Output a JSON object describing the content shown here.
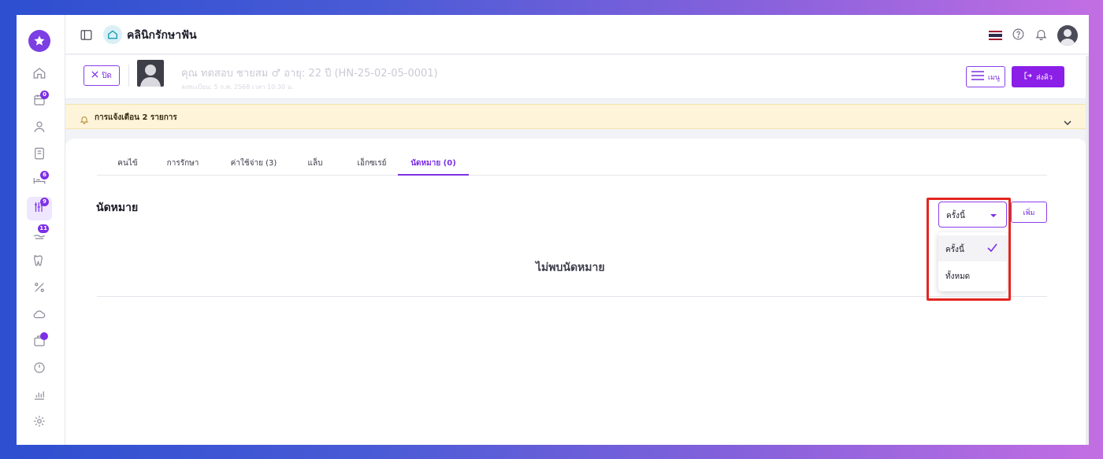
{
  "app": {
    "title": "คลินิกรักษาฟัน",
    "accent_color": "#7c2fe5",
    "flag": "thai-flag"
  },
  "sidebar": {
    "items": [
      {
        "icon": "home-icon",
        "badge": ""
      },
      {
        "icon": "calendar-icon",
        "badge": "0"
      },
      {
        "icon": "user-icon",
        "badge": ""
      },
      {
        "icon": "document-icon",
        "badge": ""
      },
      {
        "icon": "bed-icon",
        "badge": "6"
      },
      {
        "icon": "dental-tools-icon",
        "badge": "9",
        "active": true
      },
      {
        "icon": "hand-coin-icon",
        "badge": "11"
      },
      {
        "icon": "tooth-icon",
        "badge": ""
      },
      {
        "icon": "percent-icon",
        "badge": ""
      },
      {
        "icon": "cloud-icon",
        "badge": ""
      },
      {
        "icon": "box-icon",
        "badge": "•"
      },
      {
        "icon": "gauge-icon",
        "badge": ""
      },
      {
        "icon": "bar-chart-icon",
        "badge": ""
      },
      {
        "icon": "settings-icon",
        "badge": ""
      }
    ]
  },
  "patient_bar": {
    "close_label": "ปิด",
    "name": "คุณ ทดสอบ ชายสม  ♂  อายุ: 22 ปี  (HN-25-02-05-0001)",
    "sub": "ลงทะเบียน: 5 ก.พ. 2568 เวลา 10:30 น.",
    "menu_label": "เมนู",
    "send_label": "ส่งคิว"
  },
  "alert": {
    "text": "การแจ้งเตือน 2 รายการ"
  },
  "tabs": [
    {
      "label": "คนไข้"
    },
    {
      "label": "การรักษา"
    },
    {
      "label": "ค่าใช้จ่าย (3)"
    },
    {
      "label": "แล็บ"
    },
    {
      "label": "เอ็กซเรย์"
    },
    {
      "label": "นัดหมาย (0)",
      "active": true
    }
  ],
  "appointments": {
    "title": "นัดหมาย",
    "empty_text": "ไม่พบนัดหมาย",
    "filter_value": "ครั้งนี้",
    "add_label": "เพิ่ม",
    "options": [
      {
        "label": "ครั้งนี้",
        "selected": true
      },
      {
        "label": "ทั้งหมด",
        "selected": false
      }
    ]
  }
}
